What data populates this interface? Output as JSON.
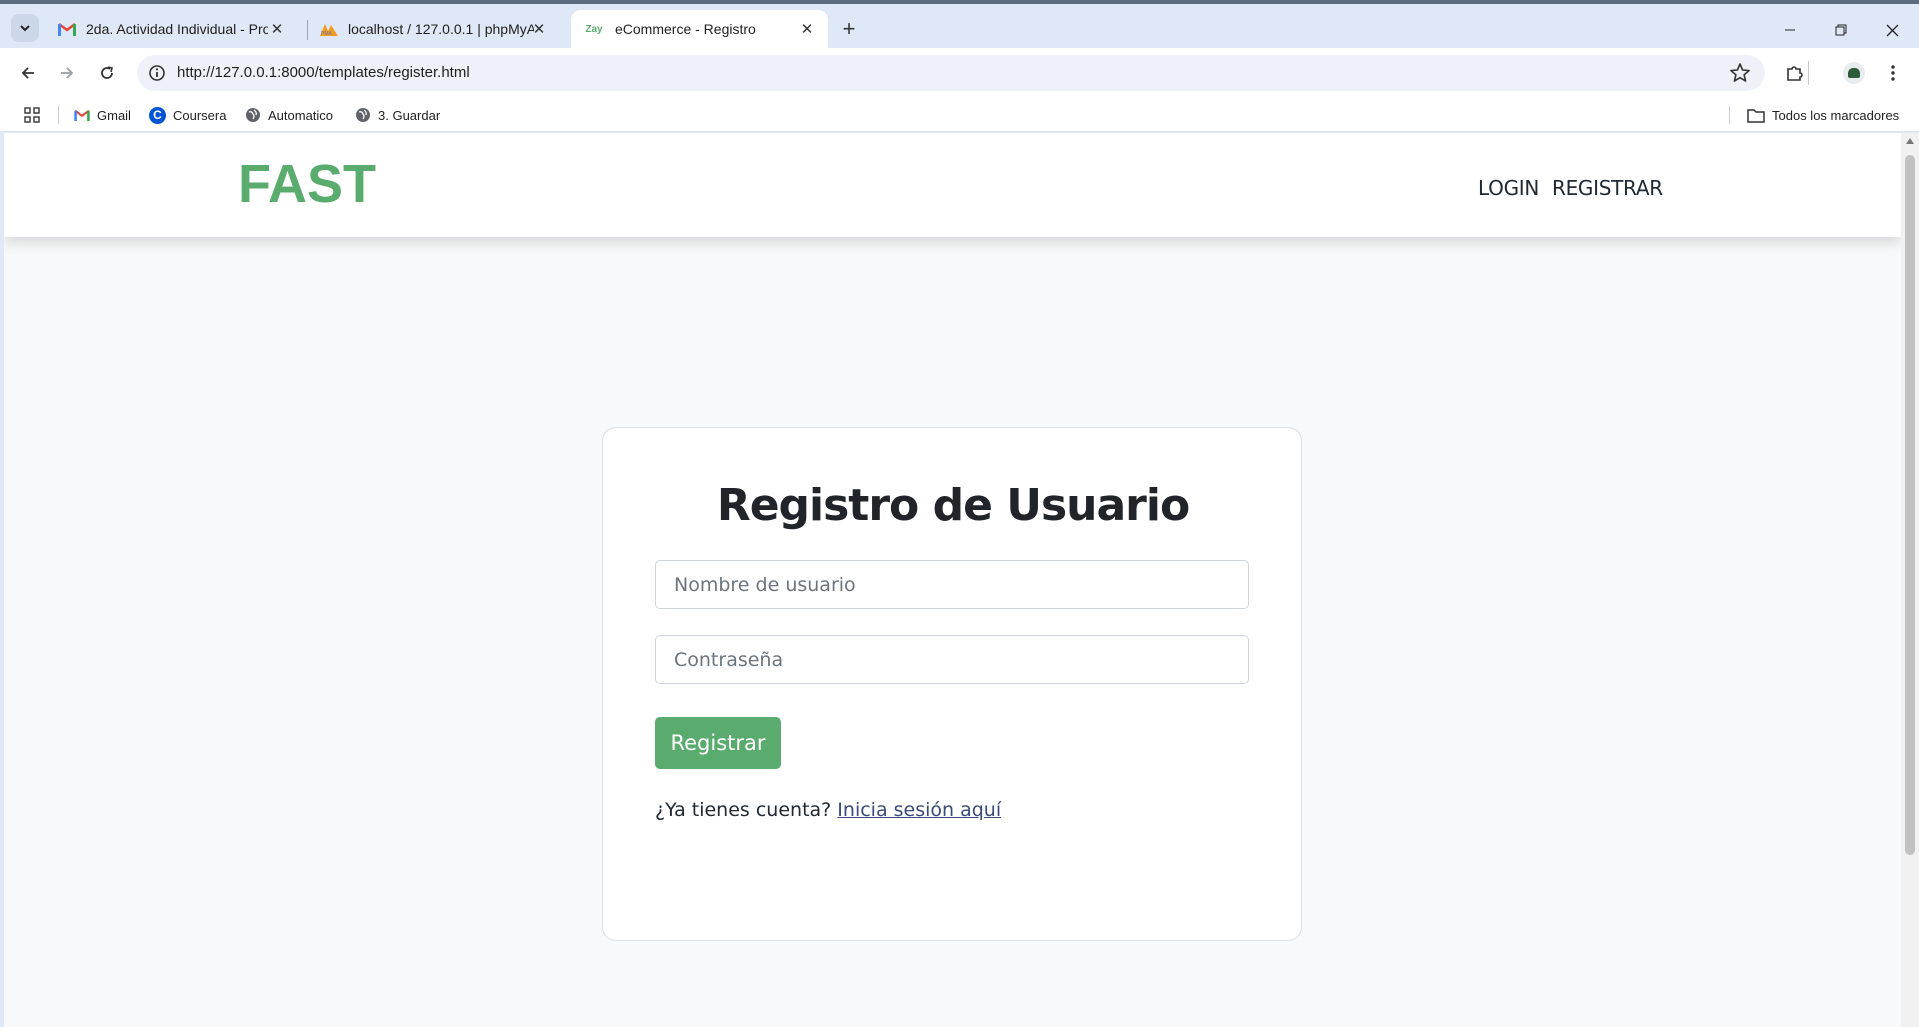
{
  "browser": {
    "tabs": [
      {
        "title": "2da. Actividad Individual - Proy",
        "icon": "gmail-icon"
      },
      {
        "title": "localhost / 127.0.0.1 | phpMyAd",
        "icon": "phpmyadmin-icon"
      },
      {
        "title": "eCommerce - Registro",
        "icon": "zay-icon",
        "favicon_text": "Zay"
      }
    ],
    "url": "http://127.0.0.1:8000/templates/register.html",
    "bookmarks": [
      {
        "label": "Gmail",
        "icon": "gmail-icon"
      },
      {
        "label": "Coursera",
        "icon": "coursera-icon"
      },
      {
        "label": "Automatico",
        "icon": "globe-icon"
      },
      {
        "label": "3. Guardar",
        "icon": "globe-icon"
      }
    ],
    "all_bookmarks_label": "Todos los marcadores"
  },
  "site": {
    "brand": "FAST",
    "nav": {
      "login": "LOGIN",
      "register": "REGISTRAR"
    },
    "brand_color": "#59ab6e"
  },
  "form": {
    "title": "Registro de Usuario",
    "username_placeholder": "Nombre de usuario",
    "password_placeholder": "Contraseña",
    "submit_label": "Registrar",
    "login_prompt": "¿Ya tienes cuenta?",
    "login_link": "Inicia sesión aquí"
  }
}
